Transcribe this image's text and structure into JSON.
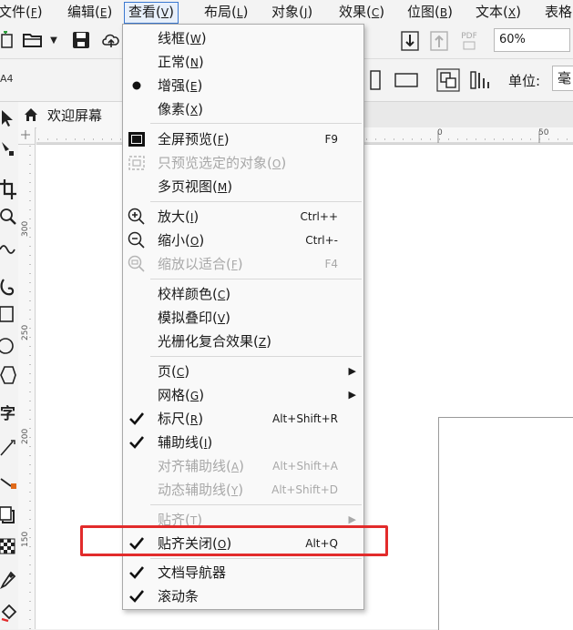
{
  "menubar": {
    "items": [
      {
        "label": "文件",
        "acc": "F"
      },
      {
        "label": "编辑",
        "acc": "E"
      },
      {
        "label": "查看",
        "acc": "V"
      },
      {
        "label": "布局",
        "acc": "L"
      },
      {
        "label": "对象",
        "acc": "J"
      },
      {
        "label": "效果",
        "acc": "C"
      },
      {
        "label": "位图",
        "acc": "B"
      },
      {
        "label": "文本",
        "acc": "X"
      },
      {
        "label": "表格",
        "acc": ""
      }
    ]
  },
  "toolbar": {
    "zoom": "60%",
    "pdf_label": "PDF",
    "unit_label": "单位:",
    "unit_value": "毫",
    "page_size": "A4"
  },
  "doc_tab": {
    "label": "欢迎屏幕"
  },
  "ruler": {
    "top": [
      "0",
      "50"
    ],
    "left": [
      "300",
      "250",
      "200",
      "150"
    ]
  },
  "view_menu": {
    "items": [
      {
        "label": "线框",
        "acc": "W",
        "shortcut": "",
        "mark": "",
        "disabled": false
      },
      {
        "label": "正常",
        "acc": "N",
        "shortcut": "",
        "mark": "",
        "disabled": false
      },
      {
        "label": "增强",
        "acc": "E",
        "shortcut": "",
        "mark": "bullet",
        "disabled": false
      },
      {
        "label": "像素",
        "acc": "X",
        "shortcut": "",
        "mark": "",
        "disabled": false
      },
      {
        "label": "全屏预览",
        "acc": "F",
        "shortcut": "F9",
        "mark": "fullscreen-icon",
        "disabled": false
      },
      {
        "label": "只预览选定的对象",
        "acc": "O",
        "shortcut": "",
        "mark": "selected-preview-icon",
        "disabled": true
      },
      {
        "label": "多页视图",
        "acc": "M",
        "shortcut": "",
        "mark": "",
        "disabled": false
      },
      {
        "label": "放大",
        "acc": "I",
        "shortcut": "Ctrl++",
        "mark": "zoom-in-icon",
        "disabled": false
      },
      {
        "label": "缩小",
        "acc": "O",
        "shortcut": "Ctrl+-",
        "mark": "zoom-out-icon",
        "disabled": false
      },
      {
        "label": "缩放以适合",
        "acc": "F",
        "shortcut": "F4",
        "mark": "zoom-fit-icon",
        "disabled": true
      },
      {
        "label": "校样颜色",
        "acc": "C",
        "shortcut": "",
        "mark": "",
        "disabled": false
      },
      {
        "label": "模拟叠印",
        "acc": "V",
        "shortcut": "",
        "mark": "",
        "disabled": false
      },
      {
        "label": "光栅化复合效果",
        "acc": "Z",
        "shortcut": "",
        "mark": "",
        "disabled": false
      },
      {
        "label": "页",
        "acc": "C",
        "shortcut": "",
        "mark": "",
        "disabled": false,
        "submenu": true
      },
      {
        "label": "网格",
        "acc": "G",
        "shortcut": "",
        "mark": "",
        "disabled": false,
        "submenu": true
      },
      {
        "label": "标尺",
        "acc": "R",
        "shortcut": "Alt+Shift+R",
        "mark": "check",
        "disabled": false
      },
      {
        "label": "辅助线",
        "acc": "I",
        "shortcut": "",
        "mark": "check",
        "disabled": false
      },
      {
        "label": "对齐辅助线",
        "acc": "A",
        "shortcut": "Alt+Shift+A",
        "mark": "",
        "disabled": true
      },
      {
        "label": "动态辅助线",
        "acc": "Y",
        "shortcut": "Alt+Shift+D",
        "mark": "",
        "disabled": true
      },
      {
        "label": "贴齐",
        "acc": "T",
        "shortcut": "",
        "mark": "",
        "disabled": true,
        "submenu": true
      },
      {
        "label": "贴齐关闭",
        "acc": "O",
        "shortcut": "Alt+Q",
        "mark": "check",
        "disabled": false
      },
      {
        "label": "文档导航器",
        "acc": "",
        "shortcut": "",
        "mark": "check",
        "disabled": false
      },
      {
        "label": "滚动条",
        "acc": "",
        "shortcut": "",
        "mark": "check",
        "disabled": false
      }
    ]
  },
  "colors": {
    "accent": "#3a78d0",
    "highlight": "#e22b2b"
  }
}
